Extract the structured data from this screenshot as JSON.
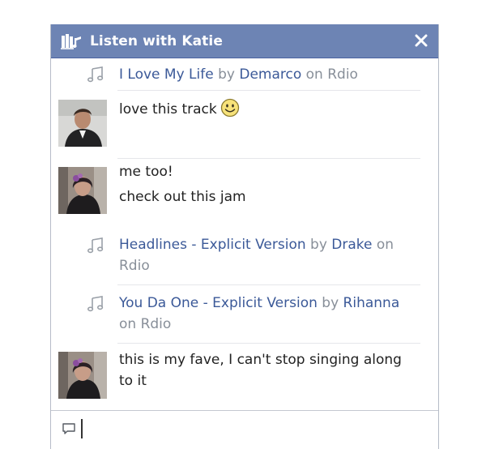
{
  "window": {
    "title": "Listen with Katie",
    "accent_color": "#6d84b4",
    "link_color": "#3b5998",
    "title_icon": "music-library-icon",
    "close_icon": "close-icon"
  },
  "messages": [
    {
      "kind": "share",
      "icon": "music-note-icon",
      "track": "I Love My Life",
      "by": "by",
      "artist": "Demarco",
      "on": "on Rdio"
    },
    {
      "kind": "chat",
      "avatar": "avatar-man",
      "lines": [
        "love this track"
      ],
      "emoji": "smiley-icon"
    },
    {
      "kind": "chat",
      "avatar": "avatar-katie",
      "lines": [
        "me too!",
        "check out this jam"
      ]
    },
    {
      "kind": "share",
      "icon": "music-note-icon",
      "track": "Headlines - Explicit Version",
      "by": "by",
      "artist": "Drake",
      "on": "on Rdio"
    },
    {
      "kind": "share",
      "icon": "music-note-icon",
      "track": "You Da One - Explicit Version",
      "by": "by",
      "artist": "Rihanna",
      "on": "on Rdio"
    },
    {
      "kind": "chat",
      "avatar": "avatar-katie",
      "lines": [
        "this is my fave, I can't stop singing along to it"
      ]
    }
  ],
  "composer": {
    "icon": "chat-bubble-icon",
    "value": "",
    "placeholder": ""
  }
}
